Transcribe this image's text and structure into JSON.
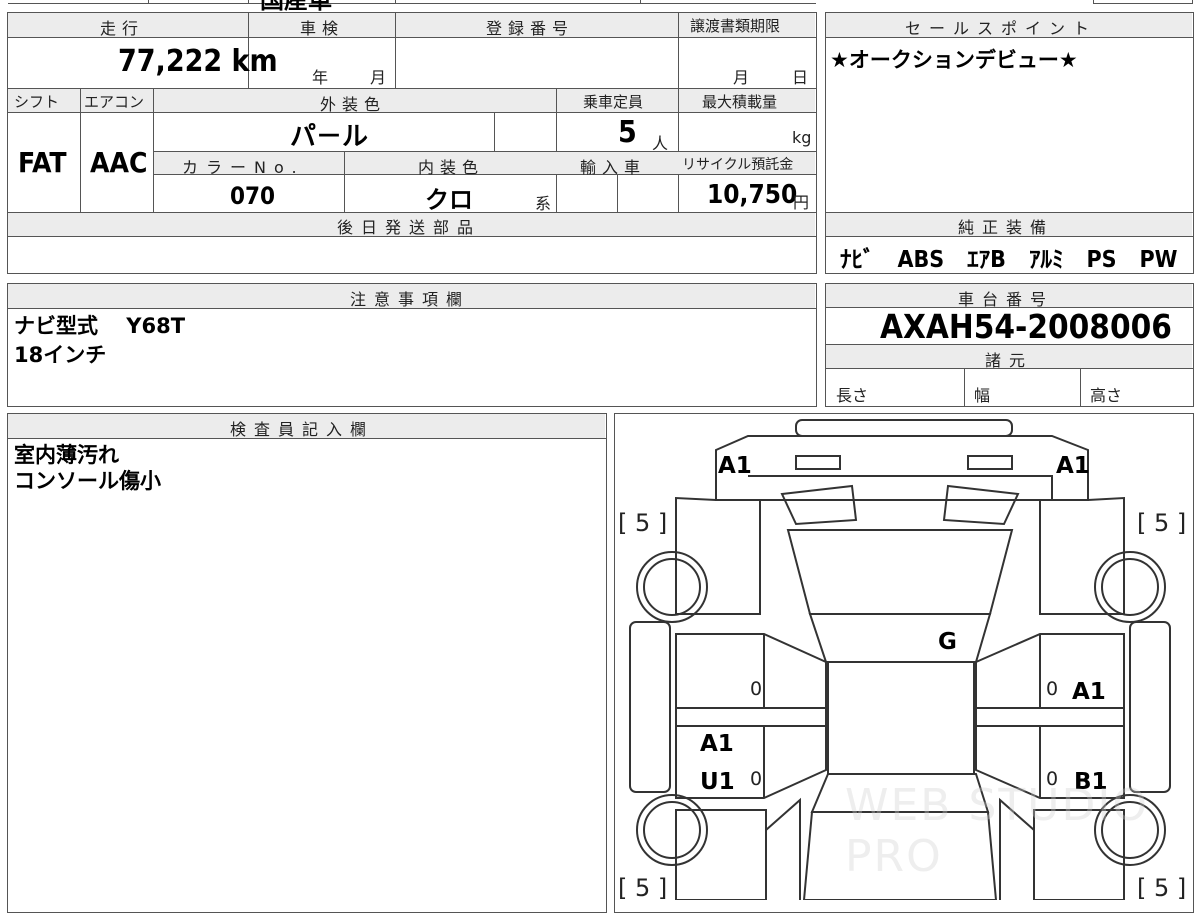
{
  "title_fragment": "国産車",
  "labels": {
    "mileage": "走行",
    "inspection": "車検",
    "registration": "登録番号",
    "transfer_deadline": "譲渡書類期限",
    "year_unit": "年",
    "month_unit": "月",
    "day_unit": "日",
    "shift": "シフト",
    "aircon": "エアコン",
    "exterior_color": "外装色",
    "capacity": "乗車定員",
    "max_load": "最大積載量",
    "color_no": "カラーNo.",
    "interior_color": "内装色",
    "import": "輸入車",
    "recycle": "リサイクル預託金",
    "later_parts": "後日発送部品",
    "notes": "注意事項欄",
    "sales_point": "セールスポイント",
    "genuine_equipment": "純正装備",
    "chassis_no": "車台番号",
    "specs": "諸元",
    "length": "長さ",
    "width": "幅",
    "height": "高さ",
    "inspector": "検査員記入欄",
    "persons_unit": "人",
    "kg_unit": "kg",
    "yen_unit": "円",
    "series_unit": "系"
  },
  "values": {
    "mileage": "77,222",
    "mileage_unit": "km",
    "shift": "FAT",
    "aircon": "AAC",
    "exterior_color": "パ－ル",
    "capacity": "5",
    "color_no": "070",
    "interior_color": "クロ",
    "recycle_fee": "10,750",
    "sales_point": "★オークションデビュー★",
    "equipment": "ﾅﾋﾞ　ABS　ｴｱB　ｱﾙﾐ　PS　PW",
    "notes_line1": "ナビ型式　 Y68T",
    "notes_line2": "18インチ",
    "chassis_no": "AXAH54-2008006",
    "inspector_line1": "室内薄汚れ",
    "inspector_line2": "コンソール傷小"
  },
  "diagram": {
    "marks": [
      "A1",
      "A1",
      "G",
      "A1",
      "A1",
      "U1",
      "B1"
    ],
    "zero": "0",
    "tire_depth": [
      "[ 5 ]",
      "[ 5 ]",
      "[ 5 ]",
      "[ 5 ]"
    ]
  },
  "watermark": "WEB STUDIO PRO"
}
